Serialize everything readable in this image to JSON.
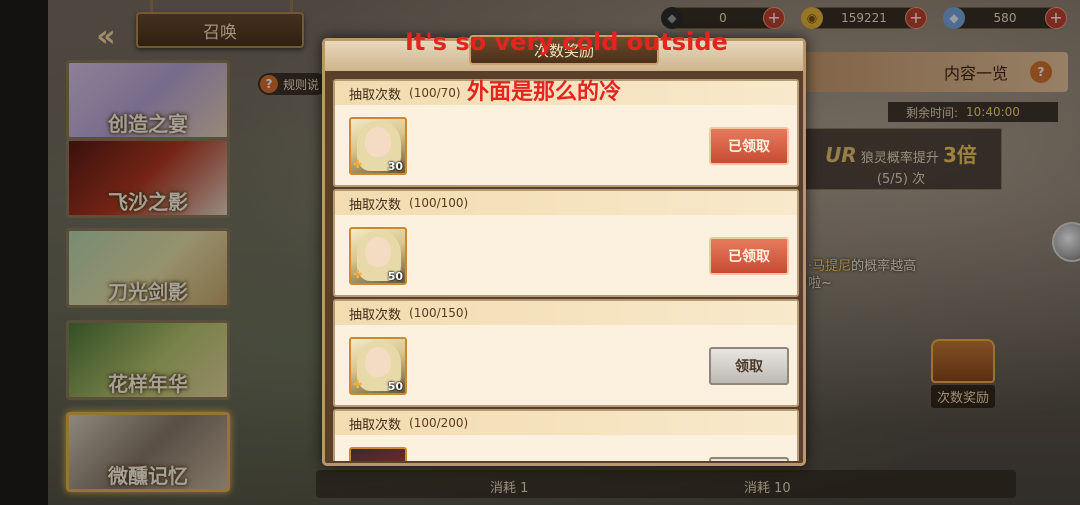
{
  "top_bar": {
    "back_icon": "double-chevron-left-icon",
    "title": "召唤",
    "resources": [
      {
        "icon": "dark-crystal-icon",
        "value": "0",
        "color": "#2b2b2b"
      },
      {
        "icon": "gold-coin-icon",
        "value": "159221",
        "color": "#e8b63a"
      },
      {
        "icon": "blue-diamond-icon",
        "value": "580",
        "color": "#7aa7e0"
      }
    ]
  },
  "banners": [
    {
      "label": "创造之宴"
    },
    {
      "label": "飞沙之影"
    },
    {
      "label": "刀光剑影"
    },
    {
      "label": "花样年华"
    },
    {
      "label": "微醺记忆"
    }
  ],
  "rules_label": "规则说",
  "right_panel": {
    "contents_title": "内容一览",
    "time_label": "剩余时间:",
    "time_value": "10:40:00",
    "rate_prefix": "UR",
    "rate_text": "狼灵概率提升",
    "rate_mult": "3倍",
    "rate_count": "(5/5) 次",
    "desc_line1_hl": "·马提尼",
    "desc_line1_rest": "的概率越高",
    "desc_line2": "啦~",
    "chest_label": "次数奖励"
  },
  "bottom": {
    "cost1": "消耗 1",
    "cost10": "消耗 10"
  },
  "modal": {
    "title": "次数奖励",
    "rows": [
      {
        "label": "抽取次数",
        "progress": "(100/70)",
        "qty": "30",
        "button": "已领取",
        "state": "claimed"
      },
      {
        "label": "抽取次数",
        "progress": "(100/100)",
        "qty": "50",
        "button": "已领取",
        "state": "claimed"
      },
      {
        "label": "抽取次数",
        "progress": "(100/150)",
        "qty": "50",
        "button": "领取",
        "state": "claim"
      },
      {
        "label": "抽取次数",
        "progress": "(100/200)",
        "qty": "",
        "button": "",
        "state": "claim"
      }
    ]
  },
  "caption": {
    "line_en": "It's so very cold outside",
    "line_zh": "外面是那么的冷"
  }
}
